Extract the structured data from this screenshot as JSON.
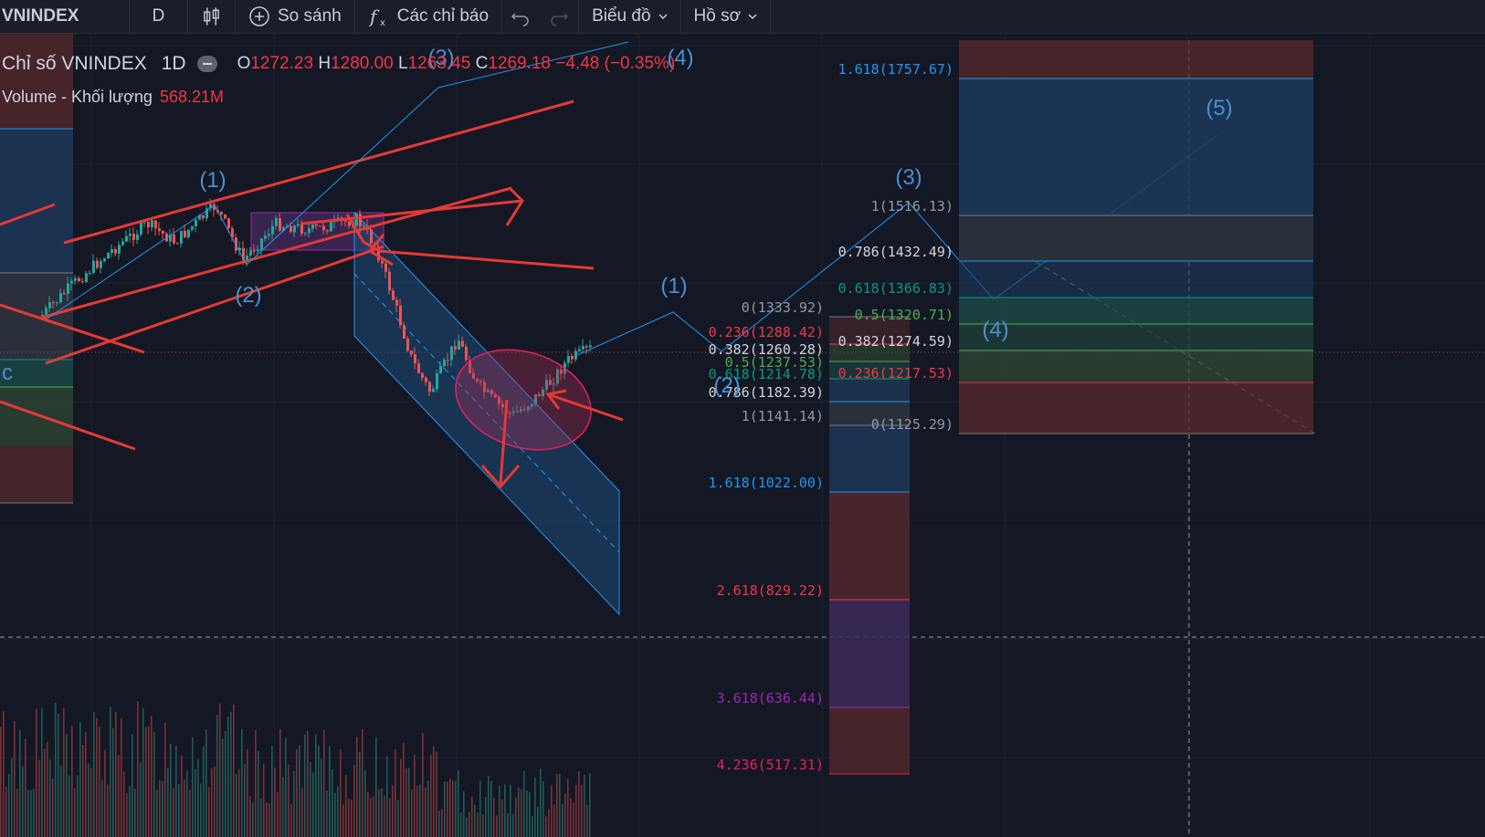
{
  "toolbar": {
    "symbol": "VNINDEX",
    "interval": "D",
    "chart_type_icon": "candlestick-icon",
    "compare_label": "So sánh",
    "indicators_label": "Các chỉ báo",
    "chart_label": "Biểu đồ",
    "profile_label": "Hồ sơ"
  },
  "legend": {
    "name": "Chỉ số VNINDEX",
    "timeframe": "1D",
    "o_label": "O",
    "o": "1272.23",
    "h_label": "H",
    "h": "1280.00",
    "l_label": "L",
    "l": "1263.45",
    "c_label": "C",
    "c": "1269.18",
    "change": "−4.48 (−0.35%)",
    "volume_label": "Volume - Khối lượng",
    "volume": "568.21M"
  },
  "waves": [
    "(1)",
    "(2)",
    "(3)",
    "(4)",
    "(1)",
    "(2)",
    "(3)",
    "(4)",
    "(5)"
  ],
  "fib_left": {
    "levels": [
      "0(1333.92)",
      "0.236(1288.42)",
      "0.382(1260.28)",
      "0.5(1237.53)",
      "0.618(1214.78)",
      "0.786(1182.39)",
      "1(1141.14)",
      "1.618(1022.00)",
      "2.618(829.22)",
      "3.618(636.44)",
      "4.236(517.31)"
    ]
  },
  "fib_right": {
    "levels": [
      "1.618(1757.67)",
      "1(1516.13)",
      "0.786(1432.49)",
      "0.618(1366.83)",
      "0.5(1320.71)",
      "0.382(1274.59)",
      "0.236(1217.53)",
      "0(1125.29)"
    ]
  },
  "colors": {
    "background": "#141824",
    "up": "#26a69a",
    "down": "#ef5350",
    "drawing_red": "#e53935",
    "fib_blue": "#2196f3",
    "fib_red": "#f23645",
    "fib_green": "#089981",
    "fib_purple": "#9c27b0",
    "fib_pink": "#e91e63"
  }
}
